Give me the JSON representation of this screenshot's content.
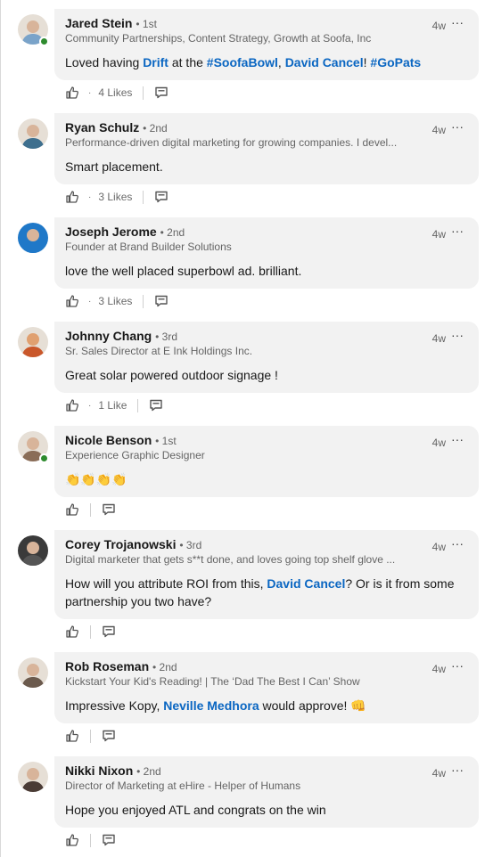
{
  "comments": [
    {
      "name": "Jared Stein",
      "degree": "• 1st",
      "headline": "Community Partnerships, Content Strategy, Growth at Soofa, Inc",
      "time": "4w",
      "more_icon": "···",
      "online": true,
      "text": [
        {
          "t": "Loved having ",
          "link": false
        },
        {
          "t": "Drift",
          "link": true
        },
        {
          "t": " at the ",
          "link": false
        },
        {
          "t": "#SoofaBowl",
          "link": true
        },
        {
          "t": ", ",
          "link": false
        },
        {
          "t": "David Cancel",
          "link": true
        },
        {
          "t": "! ",
          "link": false
        },
        {
          "t": "#GoPats",
          "link": true
        }
      ],
      "likes": "4 Likes",
      "avatar_color": "#7aa3c9"
    },
    {
      "name": "Ryan Schulz",
      "degree": "• 2nd",
      "headline": "Performance-driven digital marketing for growing companies. I devel...",
      "time": "4w",
      "more_icon": "···",
      "online": false,
      "text": [
        {
          "t": "Smart placement.",
          "link": false
        }
      ],
      "likes": "3 Likes",
      "avatar_color": "#3e6f8e"
    },
    {
      "name": "Joseph Jerome",
      "degree": "• 2nd",
      "headline": "Founder at Brand Builder Solutions",
      "time": "4w",
      "more_icon": "···",
      "online": false,
      "text": [
        {
          "t": "love the well placed superbowl ad.  brilliant.",
          "link": false
        }
      ],
      "likes": "3 Likes",
      "avatar_color": "#1f78c8"
    },
    {
      "name": "Johnny Chang",
      "degree": "• 3rd",
      "headline": "Sr. Sales Director at E Ink Holdings Inc.",
      "time": "4w",
      "more_icon": "···",
      "online": false,
      "text": [
        {
          "t": "Great solar powered outdoor signage !",
          "link": false
        }
      ],
      "likes": "1 Like",
      "avatar_color": "#c9572a"
    },
    {
      "name": "Nicole Benson",
      "degree": "• 1st",
      "headline": "Experience Graphic Designer",
      "time": "4w",
      "more_icon": "···",
      "online": true,
      "text": [
        {
          "t": "👏👏👏👏",
          "link": false
        }
      ],
      "likes": "",
      "avatar_color": "#8a6d58"
    },
    {
      "name": "Corey Trojanowski",
      "degree": "• 3rd",
      "headline": "Digital marketer that gets s**t done, and loves going top shelf glove ...",
      "time": "4w",
      "more_icon": "···",
      "online": false,
      "text": [
        {
          "t": "How will you attribute ROI from this, ",
          "link": false
        },
        {
          "t": "David Cancel",
          "link": true
        },
        {
          "t": "? Or is it from some partnership you two have?",
          "link": false
        }
      ],
      "likes": "",
      "avatar_color": "#555555"
    },
    {
      "name": "Rob Roseman",
      "degree": "• 2nd",
      "headline": "Kickstart Your Kid's Reading! | The ‘Dad The Best I Can’ Show",
      "time": "4w",
      "more_icon": "···",
      "online": false,
      "text": [
        {
          "t": "Impressive Kopy, ",
          "link": false
        },
        {
          "t": "Neville Medhora",
          "link": true
        },
        {
          "t": " would approve! 👊",
          "link": false
        }
      ],
      "likes": "",
      "avatar_color": "#6b5a4d"
    },
    {
      "name": "Nikki Nixon",
      "degree": "• 2nd",
      "headline": "Director of Marketing at eHire - Helper of Humans",
      "time": "4w",
      "more_icon": "···",
      "online": false,
      "text": [
        {
          "t": "Hope you enjoyed ATL and congrats on the win",
          "link": false
        }
      ],
      "likes": "",
      "avatar_color": "#4a3b35"
    }
  ],
  "icons": {
    "like": "thumbs-up-icon",
    "reply": "reply-icon",
    "more": "more-options-icon"
  },
  "colors": {
    "link": "#0a66c2",
    "bubble": "#f2f2f2",
    "online": "#2e8b2e"
  }
}
